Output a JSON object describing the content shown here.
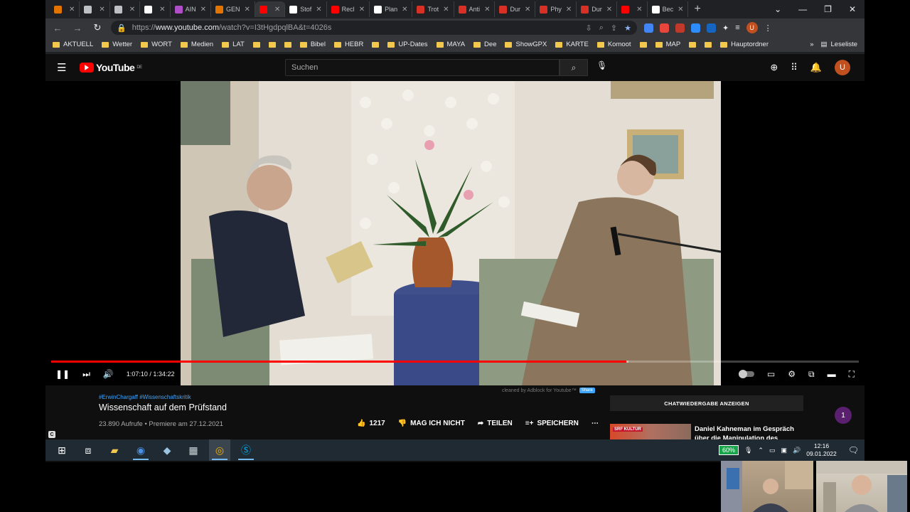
{
  "browser": {
    "tabs": [
      {
        "label": "",
        "color": "#e37400"
      },
      {
        "label": "",
        "color": "#bdc1c6"
      },
      {
        "label": "",
        "color": "#bdc1c6"
      },
      {
        "label": "",
        "color": "#ffffff"
      },
      {
        "label": "AIN",
        "color": "#b04ec7"
      },
      {
        "label": "GEN",
        "color": "#e37400"
      },
      {
        "label": "",
        "color": "#ff0000",
        "active": true
      },
      {
        "label": "Stof",
        "color": "#ffffff"
      },
      {
        "label": "Recl",
        "color": "#ff0000"
      },
      {
        "label": "Plan",
        "color": "#ffffff"
      },
      {
        "label": "Trot",
        "color": "#d93025"
      },
      {
        "label": "Anti",
        "color": "#d93025"
      },
      {
        "label": "Dur",
        "color": "#d93025"
      },
      {
        "label": "Phy",
        "color": "#d93025"
      },
      {
        "label": "Dur",
        "color": "#d93025"
      },
      {
        "label": "",
        "color": "#ff0000"
      },
      {
        "label": "Bec",
        "color": "#ffffff"
      }
    ],
    "url_prefix": "https://",
    "url_host": "www.youtube.com",
    "url_path": "/watch?v=I3tHgdpqlBA&t=4026s",
    "profile_initial": "U",
    "bookmarks": [
      "AKTUELL",
      "Wetter",
      "WORT",
      "Medien",
      "LAT",
      "",
      "",
      "",
      "Bibel",
      "HEBR",
      "",
      "UP-Dates",
      "MAYA",
      "Dee",
      "ShowGPX",
      "KARTE",
      "Komoot",
      "",
      "MAP",
      "",
      "",
      "Hauptordner"
    ],
    "bookmarks_more": "»",
    "reading_list": "Leseliste"
  },
  "youtube": {
    "logo_text": "YouTube",
    "logo_region": "DE",
    "search_placeholder": "Suchen",
    "avatar_initial": "U",
    "player": {
      "current_time": "1:07:10",
      "duration": "1:34:22",
      "played_fraction": 0.712,
      "loaded_fraction": 0.715
    },
    "adblock_note": "cleaned by Adblock for Youtube™",
    "adblock_share": "Share",
    "hashtags": "#ErwinChargaff #Wissenschaftskritik",
    "title": "Wissenschaft auf dem Prüfstand",
    "meta": "23.890 Aufrufe • Premiere am 27.12.2021",
    "likes": "1217",
    "dislike_label": "MAG ICH NICHT",
    "share_label": "TEILEN",
    "save_label": "SPEICHERN",
    "more_label": "⋯",
    "chat_replay_label": "CHATWIEDERGABE ANZEIGEN",
    "notification_count": "1",
    "related": {
      "badge": "SRF KULTUR",
      "title": "Daniel Kahneman im Gespräch über die Manipulation des"
    }
  },
  "taskbar": {
    "battery": "60%",
    "time": "12:16",
    "date": "09.01.2022"
  },
  "colors": {
    "accent": "#ff0000",
    "link": "#3ea6ff",
    "profile": "#c0501f"
  }
}
